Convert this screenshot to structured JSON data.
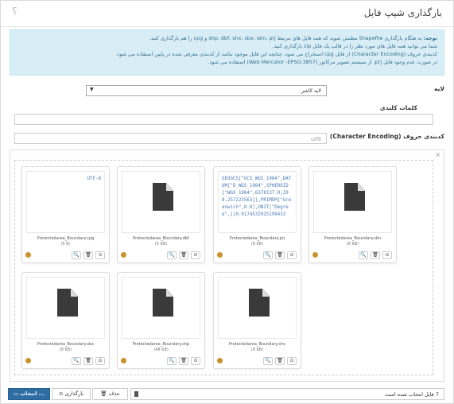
{
  "dialog": {
    "title": "بارگذاری شیپ فایل",
    "help_label": "؟"
  },
  "notice": {
    "line1_bold": "توجه:",
    "line1": "به هنگام بارگذاری Shapefile مطمئن شوید که همه فایل های مرتبط shp، dbf، shx، sbx، sbn، prj و cpg را هم بارگذاری کنید.",
    "line2": "شما می توانید همه فایل های مورد نظر را در قالب یک فایل zip بارگذاری کنید.",
    "line3": "کدبندی حروف (Character Encoding) از فایل cpg استخراج می شود، چنانچه این فایل موجود نباشد از کدبندی معرفی شده در پایین استفاده می شود.",
    "line4": "در صورت عدم وجود فایل prj، از سیستم تصویر مرکاتور (Web Mercator -EPSG:3857) استفاده می شود."
  },
  "form": {
    "layer_label": "لایه",
    "layer_value": "لایه کاشر",
    "keywords_label": "کلمات کلیدی",
    "keywords_value": "",
    "encoding_label": "کدبندی حروف (Character Encoding)",
    "encoding_placeholder": "utf8"
  },
  "files": [
    {
      "name": "Protectedarea_Boundary.cpg",
      "size": "(5 B)",
      "preview": "text",
      "preview_text": "UTF-8",
      "align": "right"
    },
    {
      "name": "Protectedarea_Boundary.dbf",
      "size": "(5 KB)",
      "preview": "icon"
    },
    {
      "name": "Protectedarea_Boundary.prj",
      "size": "(8 KB)",
      "preview": "text",
      "preview_text": "GEOGCS[\"GCS_WGS_1984\",DATUM[\"D_WGS_1984\",SPHEROID[\"WGS_1984\",6378137.0,298.257223563]],PRIMEM[\"Greenwich\",0.0],UNIT[\"Degree\",[[0.0174532925199433",
      "align": "left"
    },
    {
      "name": "Protectedarea_Boundary.sbn",
      "size": "(8 KB)",
      "preview": "icon"
    },
    {
      "name": "Protectedarea_Boundary.sbx",
      "size": "(8 KB)",
      "preview": "icon"
    },
    {
      "name": "Protectedarea_Boundary.shp",
      "size": "(48 KB)",
      "preview": "icon"
    },
    {
      "name": "Protectedarea_Boundary.shx",
      "size": "(8 KB)",
      "preview": "icon"
    }
  ],
  "card_buttons": {
    "zoom": "🔍",
    "delete": "🗑",
    "upload": "⊙"
  },
  "footer": {
    "caption": "7 فایل انتخاب شده است",
    "delete_label": "حذف",
    "upload_label": "بارگذاری",
    "browse_label": "انتخاب ..."
  },
  "colors": {
    "primary": "#2e6da4",
    "notice_bg": "#d9edf7",
    "notice_text": "#31708f",
    "link": "#4a7ab8"
  }
}
